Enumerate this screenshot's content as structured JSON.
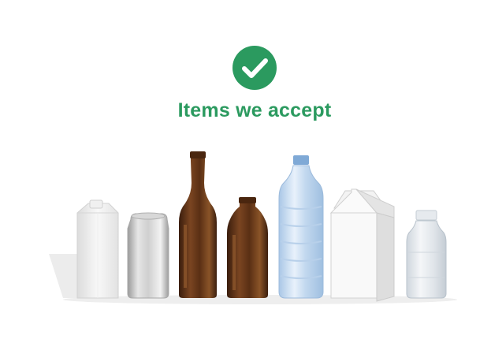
{
  "header": {
    "title": "Items we accept",
    "icon": "check-circle-icon",
    "accent_color": "#2b9a5f"
  },
  "items": [
    {
      "name": "carton-small-icon"
    },
    {
      "name": "aluminum-can-icon"
    },
    {
      "name": "brown-glass-bottle-tall-icon"
    },
    {
      "name": "brown-glass-bottle-short-icon"
    },
    {
      "name": "plastic-water-bottle-icon"
    },
    {
      "name": "milk-carton-icon"
    },
    {
      "name": "clear-glass-jar-bottle-icon"
    }
  ]
}
